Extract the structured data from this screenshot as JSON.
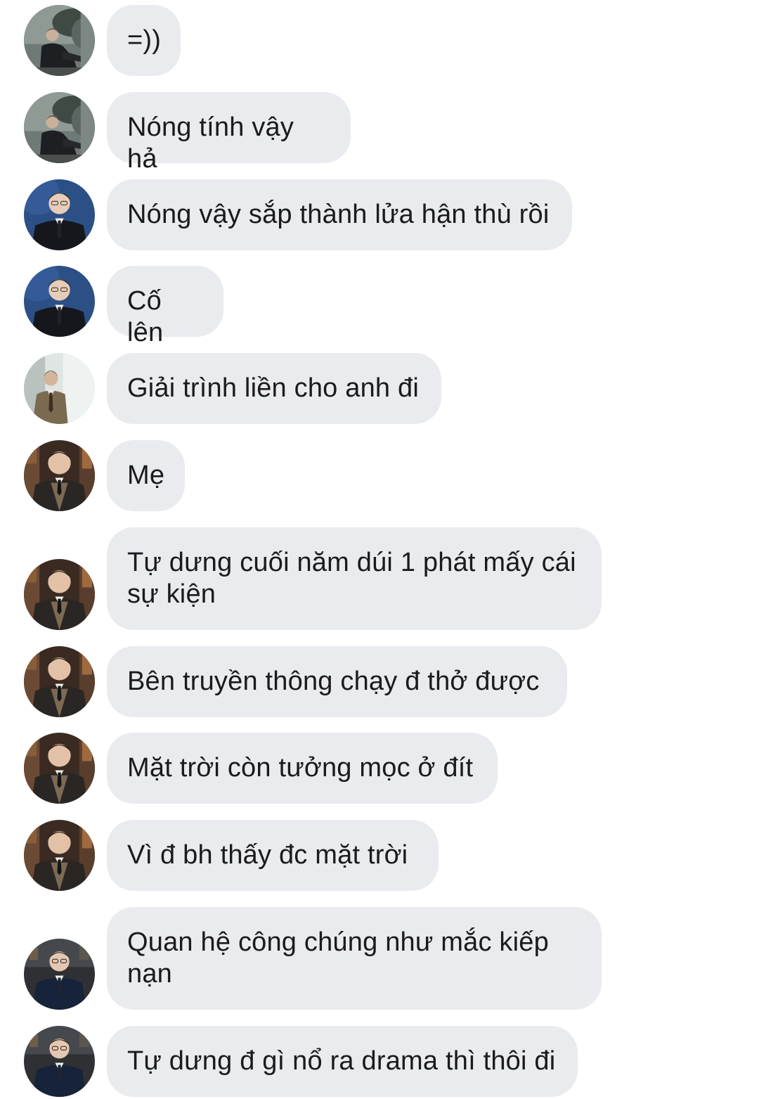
{
  "messages": [
    {
      "text": "=))",
      "avatar_icon": "avatar-man-seated-in-nature"
    },
    {
      "text": "Nóng tính vậy hả",
      "avatar_icon": "avatar-man-seated-in-nature"
    },
    {
      "text": "Nóng vậy sắp thành lửa hận thù rồi",
      "avatar_icon": "avatar-man-suit-blue-bg"
    },
    {
      "text": "Cố lên",
      "avatar_icon": "avatar-man-suit-blue-bg"
    },
    {
      "text": "Giải trình liền cho anh đi",
      "avatar_icon": "avatar-man-tweed-coat"
    },
    {
      "text": "Mẹ",
      "avatar_icon": "avatar-man-suit-dark-room"
    },
    {
      "text": "Tự dưng cuối năm dúi 1 phát mấy cái sự kiện",
      "avatar_icon": "avatar-man-suit-dark-room"
    },
    {
      "text": "Bên truyền thông chạy đ thở được",
      "avatar_icon": "avatar-man-suit-dark-room"
    },
    {
      "text": "Mặt trời còn tưởng mọc ở đít",
      "avatar_icon": "avatar-man-suit-dark-room"
    },
    {
      "text": "Vì đ bh thấy đc mặt trời",
      "avatar_icon": "avatar-man-suit-dark-room"
    },
    {
      "text": "Quan hệ công chúng như mắc kiếp nạn",
      "avatar_icon": "avatar-man-glasses-office"
    },
    {
      "text": "Tự dưng đ gì nổ ra drama thì thôi đi",
      "avatar_icon": "avatar-man-glasses-office"
    }
  ],
  "colors": {
    "bubble_bg": "#e9ebef",
    "text": "#1b1b1b",
    "background": "#ffffff"
  }
}
